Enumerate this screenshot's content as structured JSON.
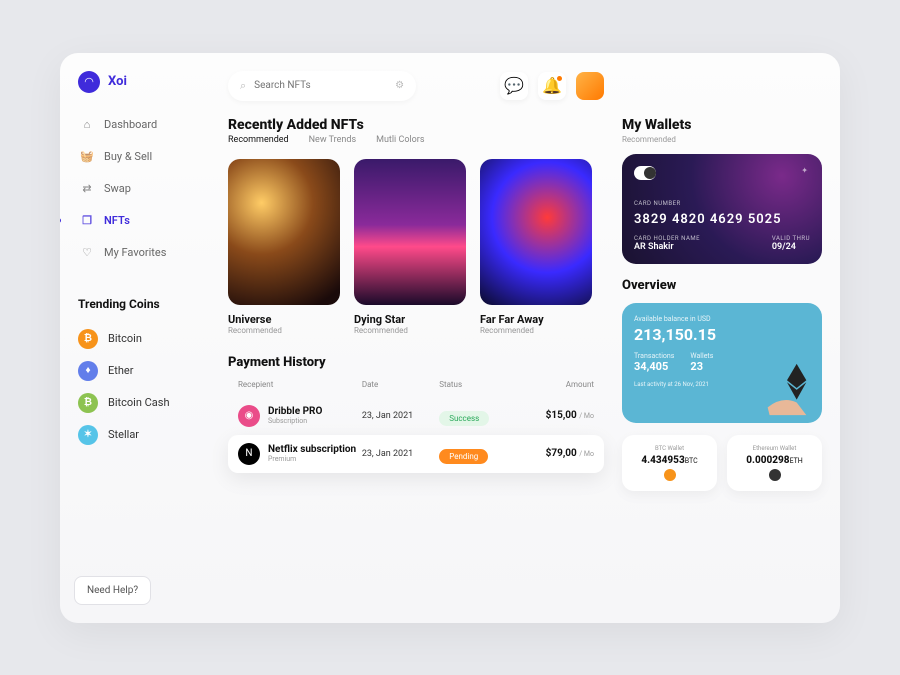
{
  "brand": "Xoi",
  "search_placeholder": "Search NFTs",
  "nav": [
    {
      "label": "Dashboard"
    },
    {
      "label": "Buy & Sell"
    },
    {
      "label": "Swap"
    },
    {
      "label": "NFTs"
    },
    {
      "label": "My Favorites"
    }
  ],
  "trending_head": "Trending Coins",
  "coins": [
    {
      "label": "Bitcoin",
      "color": "#f7931a",
      "sym": "B"
    },
    {
      "label": "Ether",
      "color": "#627eea",
      "sym": "♦"
    },
    {
      "label": "Bitcoin Cash",
      "color": "#8dc351",
      "sym": "B"
    },
    {
      "label": "Stellar",
      "color": "#56c4e8",
      "sym": "✶"
    }
  ],
  "help": "Need Help?",
  "recent": {
    "title": "Recently Added NFTs",
    "tabs": [
      "Recommended",
      "New Trends",
      "Mutli Colors"
    ],
    "items": [
      {
        "name": "Universe",
        "sub": "Recommended"
      },
      {
        "name": "Dying Star",
        "sub": "Recommended"
      },
      {
        "name": "Far Far Away",
        "sub": "Recommended"
      }
    ]
  },
  "wallets": {
    "title": "My Wallets",
    "sub": "Recommended",
    "card": {
      "num_label": "CARD NUMBER",
      "number": "3829 4820 4629 5025",
      "holder_label": "CARD HOLDER NAME",
      "holder": "AR Shakir",
      "valid_label": "VALID THRU",
      "valid": "09/24"
    }
  },
  "overview": {
    "title": "Overview",
    "bal_label": "Available balance in USD",
    "balance": "213,150.15",
    "tx_label": "Transactions",
    "tx": "34,405",
    "w_label": "Wallets",
    "w": "23",
    "activity": "Last activity at 26 Nov, 2021"
  },
  "wboxes": [
    {
      "label": "BTC Wallet",
      "amt": "4.434953",
      "unit": "BTC",
      "color": "#f7931a"
    },
    {
      "label": "Ethereum Wallet",
      "amt": "0.000298",
      "unit": "ETH",
      "color": "#333"
    }
  ],
  "payments": {
    "title": "Payment History",
    "headers": [
      "Recepient",
      "Date",
      "Status",
      "Amount"
    ],
    "rows": [
      {
        "name": "Dribble PRO",
        "sub": "Subscription",
        "date": "23, Jan 2021",
        "status": "Success",
        "status_cls": "success",
        "amt": "$15,00",
        "per": "/ Mo",
        "color": "#ea4c89"
      },
      {
        "name": "Netflix subscription",
        "sub": "Premium",
        "date": "23, Jan 2021",
        "status": "Pending",
        "status_cls": "pending",
        "amt": "$79,00",
        "per": "/ Mo",
        "color": "#e50914"
      }
    ]
  }
}
